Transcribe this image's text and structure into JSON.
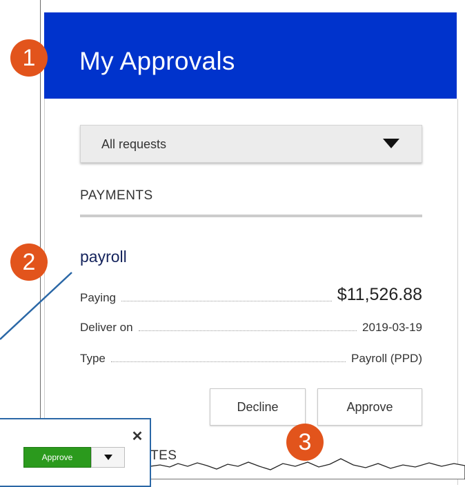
{
  "header": {
    "title": "My Approvals"
  },
  "filter": {
    "selected": "All requests"
  },
  "section": {
    "title": "PAYMENTS",
    "next_title_partial": "TES"
  },
  "payment": {
    "payee": "payroll",
    "paying_label": "Paying",
    "paying_value": "$11,526.88",
    "deliver_label": "Deliver on",
    "deliver_value": "2019-03-19",
    "type_label": "Type",
    "type_value": "Payroll (PPD)"
  },
  "buttons": {
    "decline": "Decline",
    "approve": "Approve"
  },
  "callouts": {
    "one": "1",
    "two": "2",
    "three": "3"
  },
  "popup": {
    "approve": "Approve",
    "close": "✕"
  },
  "colors": {
    "header": "#0033cc",
    "badge": "#e2541c",
    "approve_green": "#2b9a1d",
    "connector": "#2a67a6"
  }
}
